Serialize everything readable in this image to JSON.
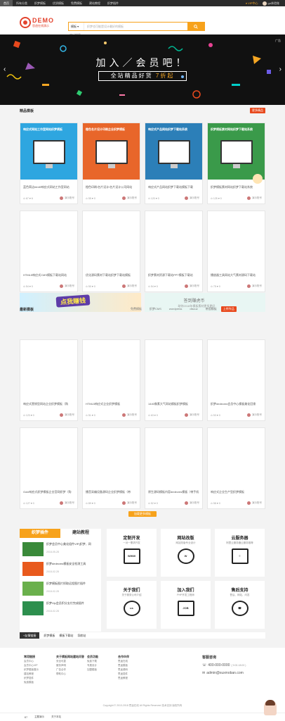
{
  "topbar": {
    "items": [
      "首页",
      "所有分类",
      "织梦模板",
      "优质模板",
      "免费模板",
      "建站教程",
      "织梦插件"
    ],
    "vip": "VIP中心",
    "user": "go体验账"
  },
  "logo": {
    "name": "DEMO",
    "slogan": "思途在线演示"
  },
  "search": {
    "select": "模板",
    "placeholder": "织梦也可能是设计最好的模板",
    "hot": "热门搜索"
  },
  "banner": {
    "line1": "加入／会员吧！",
    "line2a": "全站精品好货",
    "line2b": "7折起",
    "tag": "广告"
  },
  "section1": {
    "title": "精品模板",
    "more": "更多精品"
  },
  "featured": [
    {
      "headline": "响应式网站工作室网站织梦模板",
      "sub": "精品优质下载就到思途",
      "name": "蓝色简洁html5响应式网站工作室网站",
      "stats": "⊙ 67  ♥ 6",
      "author": "演示账号",
      "color": "#2ea6e0"
    },
    {
      "headline": "橙色名片设计印刷企业织梦模板",
      "sub": "精品优质下载就到思途",
      "name": "橙色印刷/名片设计/名片设计公司网站",
      "stats": "⊙ 55  ♥ 0",
      "author": "演示账号",
      "color": "#e8662a"
    },
    {
      "headline": "响应式产品网站织梦下载站系统",
      "sub": "精品优质下载就到思途",
      "name": "响应式产品网站织梦下载站模板下载",
      "stats": "⊙ 120  ♥ 0",
      "author": "演示账号",
      "color": "#2c7fb8"
    },
    {
      "headline": "织梦模板素材网站织梦下载站系统",
      "sub": "精品优质下载就到思途",
      "name": "织梦模板素材网站织梦下载站系统",
      "stats": "⊙ 125  ♥ 0",
      "author": "演示账号",
      "color": "#3a9a4a"
    }
  ],
  "row2": [
    {
      "name": "HTML5响应式CMS模板下载站网站",
      "stats": "⊙ 54  ♥ 0",
      "author": "演示账号"
    },
    {
      "name": "优化源码素材下载站织梦下载站模板",
      "stats": "⊙ 50  ♥ 0",
      "author": "演示账号"
    },
    {
      "name": "织梦素材资源下载站PPT模板下载站",
      "stats": "⊙ 54  ♥ 0",
      "author": "演示账号"
    },
    {
      "name": "播放器工具网站大气素材源码下载站",
      "stats": "⊙ 75  ♥ 0",
      "author": "演示账号"
    }
  ],
  "ads": {
    "ad1": "点我赚钱",
    "ad2_title": "答到赚虎币",
    "ad2_sub": "助你2018年模板素材更多更好"
  },
  "section2": {
    "title": "最新模板",
    "tabs": [
      "免费模板",
      "织梦CMS",
      "wordpress",
      "discuz",
      "帝国模板"
    ],
    "more": "上传作品"
  },
  "latest1": [
    {
      "name": "响应式营销型网站企业织梦模板（购",
      "stats": "⊙ 123  ♥ 0",
      "author": "演示账号"
    },
    {
      "name": "HTML5响应式企业织梦模板",
      "stats": "⊙ 51  ♥ 0",
      "author": "演示账号"
    },
    {
      "name": "1440像素大气网站模板织梦模板",
      "stats": "⊙ 63  ♥ 0",
      "author": "演示账号"
    },
    {
      "name": "织梦dedecms会员中心模板美化回馈",
      "stats": "⊙ 53  ♥ 0",
      "author": "演示账号"
    }
  ],
  "latest2": [
    {
      "name": "Gold响应式织梦模板企业官网织梦（购",
      "stats": "⊙ 127  ♥ 0",
      "author": "演示账号"
    },
    {
      "name": "播音采编设备源码企业织梦模板（带",
      "stats": "⊙ 89  ♥ 0",
      "author": "演示账号"
    },
    {
      "name": "原生源码模板内容dedecms模板（带手机",
      "stats": "⊙ 52  ♥ 0",
      "author": "演示账号"
    },
    {
      "name": "响应式企业生产型织梦模板",
      "stats": "⊙ 58  ♥ 0",
      "author": "演示账号"
    }
  ],
  "more_btn": "加载更多模板",
  "panel": {
    "tab1": "织梦插件",
    "tab2": "建站教程",
    "items": [
      {
        "title": "织梦会员中心美化组件VIP(织梦、网",
        "date": "2018-05-28"
      },
      {
        "title": "织梦dedecms模板安全检测工具",
        "date": "2018-02-28"
      },
      {
        "title": "织梦模板图片抓取远程图片插件",
        "date": "2018-02-28"
      },
      {
        "title": "织梦Vip会员积分支付完成插件",
        "date": "2018-02-28"
      }
    ]
  },
  "services": [
    {
      "title": "定制开发",
      "sub": "一对一需求开发",
      "icon": "WWW"
    },
    {
      "title": "网站改版",
      "sub": "网站改版专业设计",
      "icon": "W"
    },
    {
      "title": "云服务器",
      "sub": "阿里云服务器云服务推荐",
      "icon": "≡"
    },
    {
      "title": "关于我们",
      "sub": "关于服务公司介绍",
      "icon": "us"
    },
    {
      "title": "加入我们",
      "sub": "PHP开发工程师",
      "icon": "JOB"
    },
    {
      "title": "售后支持",
      "sub": "售后、网站、问答",
      "icon": "☎"
    }
  ],
  "tags": {
    "label": "+友情链接",
    "links": [
      "织梦模板",
      "模板下载站",
      "导航站"
    ]
  },
  "footer": {
    "cols": [
      {
        "h": "常用链接",
        "items": [
          "会员中心",
          "会员中心VIP",
          "织梦模板展示",
          "建站教程",
          "织梦插件",
          "免费模板"
        ]
      },
      {
        "h": "关于模板网站建站问答",
        "items": [
          "安全可靠",
          "服务声明",
          "广告合作",
          "帮助中心"
        ]
      },
      {
        "h": "会员功能",
        "items": [
          "免费下载",
          "专属设计",
          "加盟模板"
        ]
      },
      {
        "h": "合作伙伴",
        "items": [
          "思途在线",
          "思途模板",
          "思途源码",
          "思途插件",
          "思途教程"
        ]
      }
    ],
    "service_title": "客服咨询",
    "phone": "400-000-0000",
    "phone_sub": "( 9:00-18:00 )",
    "email": "admin@xuxmoban.com",
    "copyright": "Copyright © 2013-2018 思途在线 All Rights Reserved  技术支持 版权所有",
    "bottom": [
      "·87",
      "主题演示",
      "关于本站"
    ]
  }
}
